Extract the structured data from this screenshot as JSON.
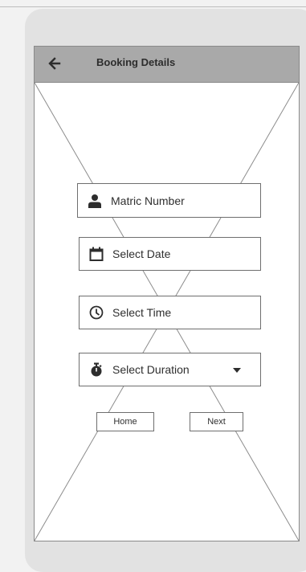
{
  "header": {
    "title": "Booking Details",
    "back_icon": "arrow-left-icon"
  },
  "form": {
    "matric": {
      "label": "Matric Number",
      "icon": "user-icon"
    },
    "date": {
      "label": "Select Date",
      "icon": "calendar-icon"
    },
    "time": {
      "label": "Select Time",
      "icon": "clock-icon"
    },
    "duration": {
      "label": "Select Duration",
      "icon": "stopwatch-icon",
      "caret_icon": "caret-down-icon"
    }
  },
  "buttons": {
    "home": "Home",
    "next": "Next"
  },
  "colors": {
    "header_bg": "#a9a9a9",
    "frame_bg": "#e2e2e2",
    "page_bg": "#f2f2f2"
  }
}
